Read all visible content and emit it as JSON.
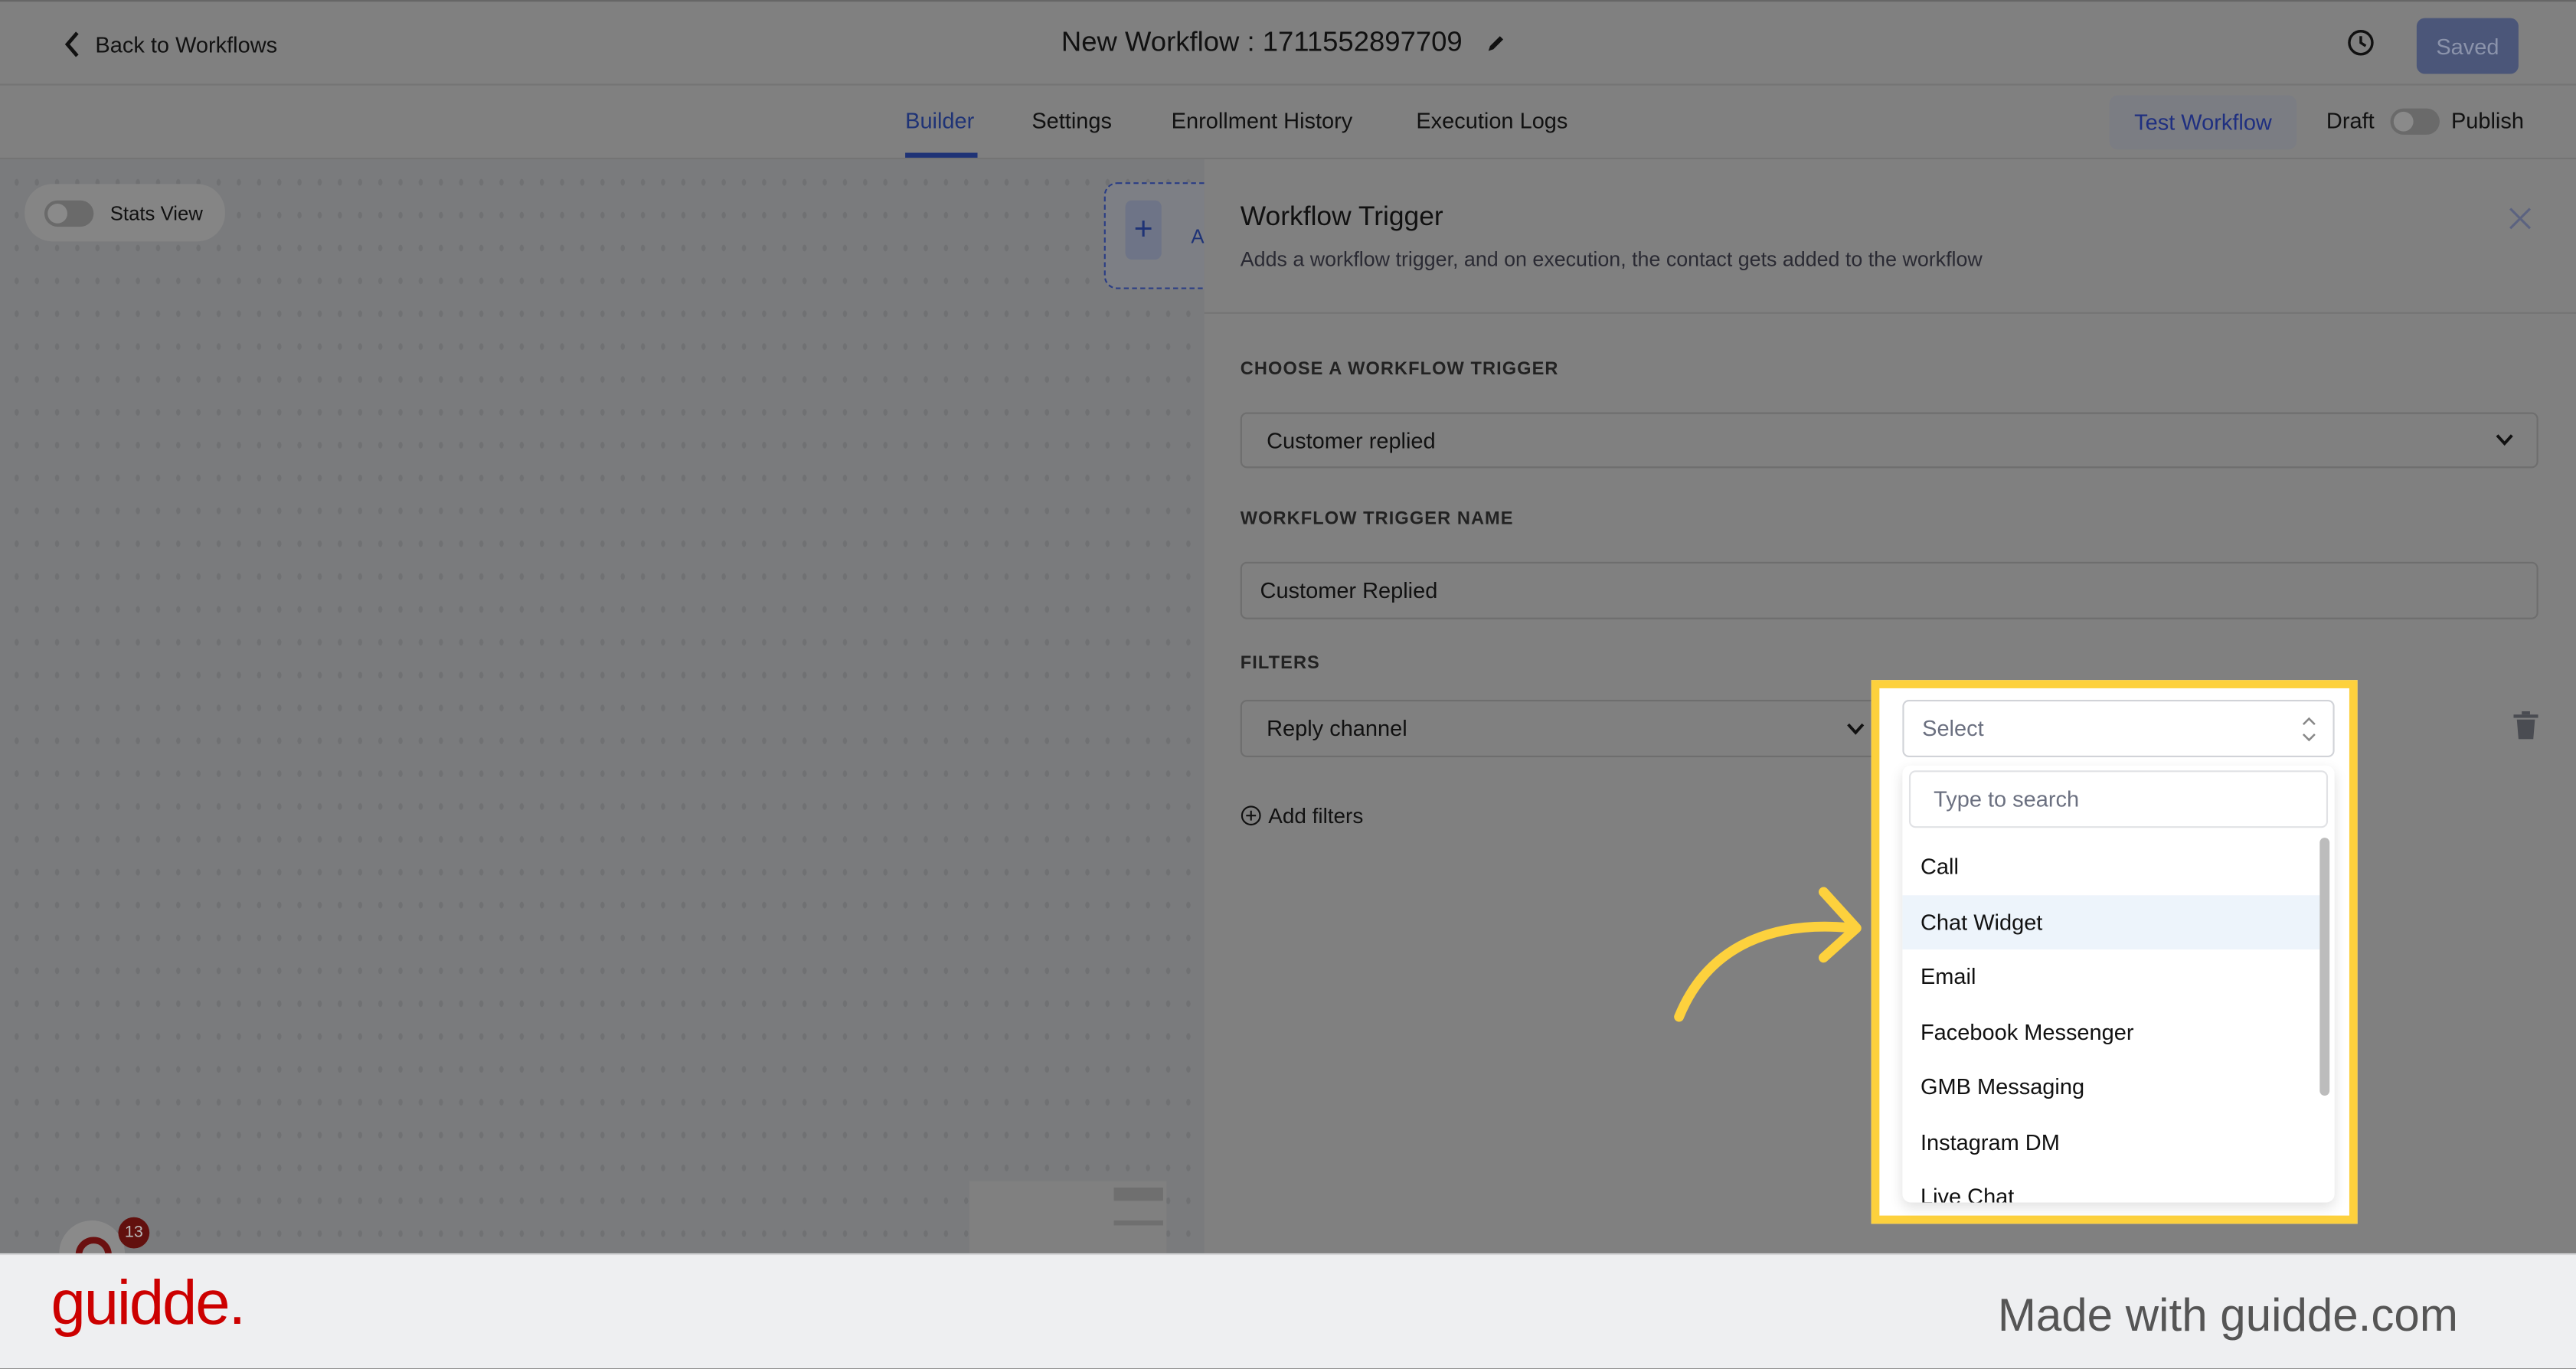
{
  "header": {
    "back_label": "Back to Workflows",
    "title": "New Workflow : 1711552897709",
    "saved_label": "Saved"
  },
  "tabs": [
    {
      "label": "Builder",
      "active": true
    },
    {
      "label": "Settings"
    },
    {
      "label": "Enrollment History"
    },
    {
      "label": "Execution Logs"
    }
  ],
  "actions": {
    "test_workflow": "Test Workflow",
    "draft": "Draft",
    "publish": "Publish"
  },
  "canvas": {
    "stats_view": "Stats View",
    "add_node_letter": "A",
    "notification_count": "13"
  },
  "panel": {
    "title": "Workflow Trigger",
    "subtitle": "Adds a workflow trigger, and on execution, the contact gets added to the workflow",
    "trigger_label": "CHOOSE A WORKFLOW TRIGGER",
    "trigger_value": "Customer replied",
    "name_label": "WORKFLOW TRIGGER NAME",
    "name_value": "Customer Replied",
    "filters_label": "FILTERS",
    "filter_field": "Reply channel",
    "filter_value_placeholder": "Select",
    "add_filters": "Add filters"
  },
  "dropdown": {
    "search_placeholder": "Type to search",
    "options": [
      "Call",
      "Chat Widget",
      "Email",
      "Facebook Messenger",
      "GMB Messaging",
      "Instagram DM",
      "Live Chat"
    ],
    "highlighted": "Chat Widget"
  },
  "colors": {
    "accent": "#1e3a8a",
    "highlight_box": "#fdd13d",
    "brand": "#cc0000"
  },
  "footer": {
    "logo": "guidde.",
    "made_with": "Made with guidde.com"
  }
}
